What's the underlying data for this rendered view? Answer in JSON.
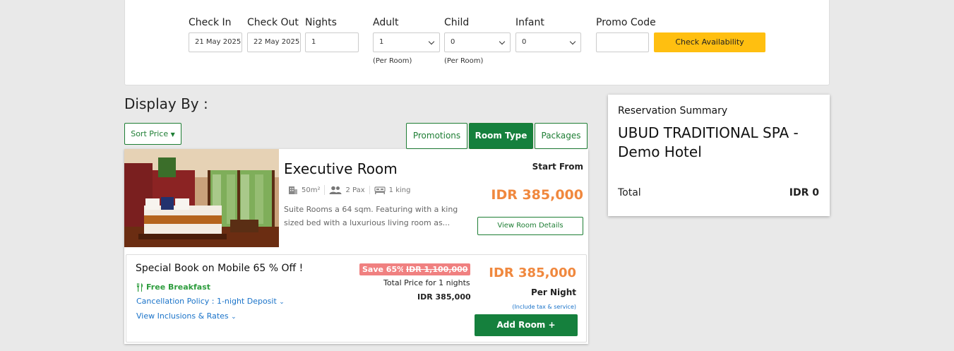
{
  "search": {
    "check_in": {
      "label": "Check In",
      "value": "21 May 2025"
    },
    "check_out": {
      "label": "Check Out",
      "value": "22 May 2025"
    },
    "nights": {
      "label": "Nights",
      "value": "1"
    },
    "adult": {
      "label": "Adult",
      "value": "1",
      "note": "(Per Room)"
    },
    "child": {
      "label": "Child",
      "value": "0",
      "note": "(Per Room)"
    },
    "infant": {
      "label": "Infant",
      "value": "0"
    },
    "promo": {
      "label": "Promo Code",
      "value": ""
    },
    "check_button": "Check Availability"
  },
  "display": {
    "heading": "Display By :",
    "sort_label": "Sort Price",
    "tabs": [
      "Promotions",
      "Room Type",
      "Packages"
    ],
    "active_tab": "Room Type"
  },
  "room": {
    "title": "Executive Room",
    "size": "50m²",
    "pax": "2 Pax",
    "bed": "1 king",
    "description": "Suite Rooms a 64 sqm. Featuring with a king sized bed with a luxurious living room as...",
    "start_from": "Start From",
    "price": "IDR 385,000",
    "view_details": "View Room Details",
    "rate": {
      "title": "Special Book on Mobile 65 % Off !",
      "breakfast": "Free Breakfast",
      "cancellation": "Cancellation Policy : 1-night Deposit",
      "inclusions": "View Inclusions & Rates",
      "save": "Save 65%",
      "old_price": "IDR 1,100,000",
      "total_nights": "Total Price for 1 nights",
      "total_price": "IDR 385,000",
      "price": "IDR 385,000",
      "per_night": "Per Night",
      "tax_note": "(Include tax & service)",
      "add_room": "Add Room  +"
    }
  },
  "summary": {
    "heading": "Reservation Summary",
    "hotel": "UBUD TRADITIONAL SPA - Demo Hotel",
    "total_label": "Total",
    "total_value": "IDR 0"
  },
  "colors": {
    "green": "#15803d",
    "orange_price": "#f0883e",
    "yellow_button": "#ffbf10",
    "link_blue": "#1a73c9",
    "save_red": "#f08080"
  }
}
